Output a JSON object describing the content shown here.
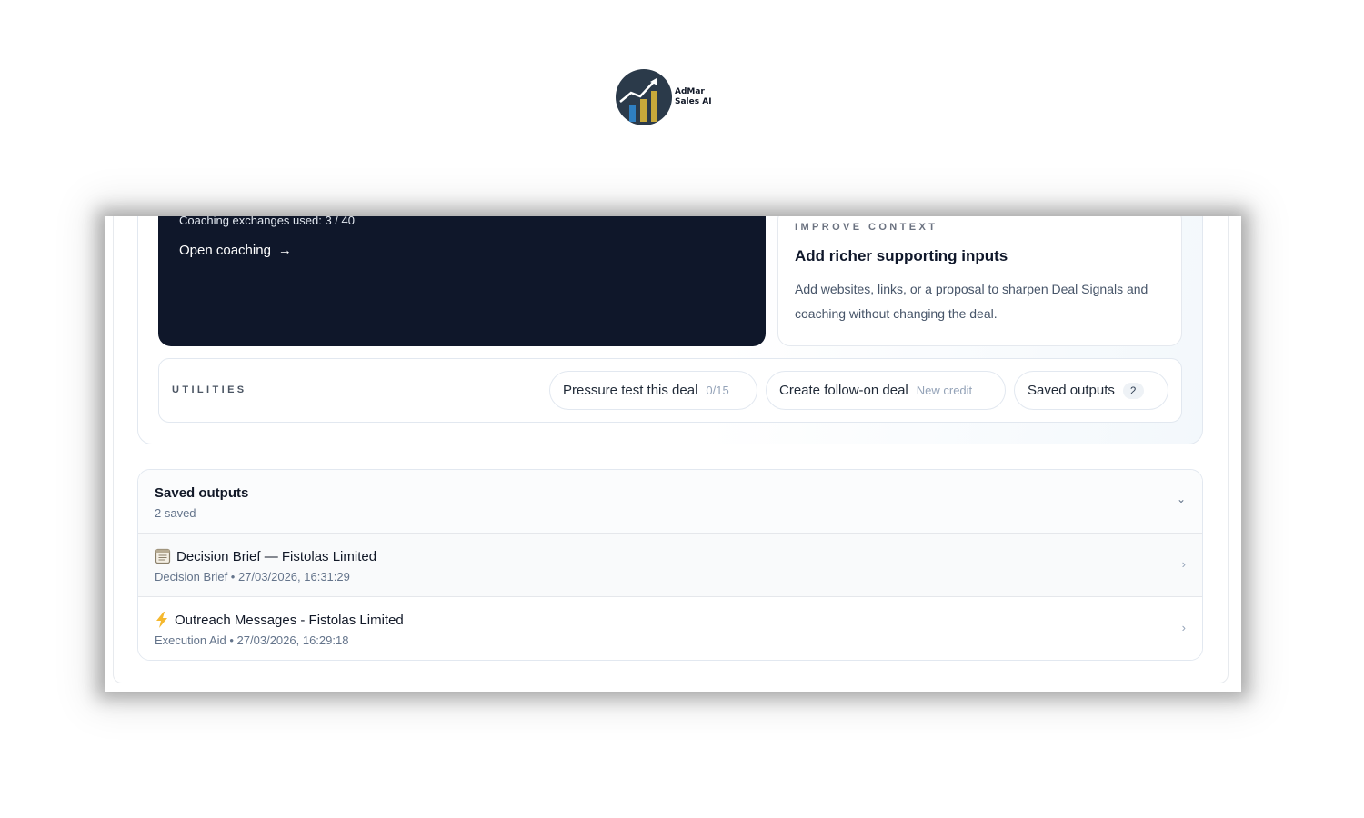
{
  "logo": {
    "line1": "AdMar",
    "line2": "Sales AI"
  },
  "coaching": {
    "usage": "Coaching exchanges used: 3 / 40",
    "link_label": "Open coaching"
  },
  "context": {
    "eyebrow": "IMPROVE CONTEXT",
    "title": "Add richer supporting inputs",
    "body": "Add websites, links, or a proposal to sharpen Deal Signals and coaching without changing the deal."
  },
  "utilities": {
    "label": "UTILITIES",
    "pressure": {
      "label": "Pressure test this deal",
      "meta": "0/15"
    },
    "followon": {
      "label": "Create follow-on deal",
      "meta": "New credit"
    },
    "saved": {
      "label": "Saved outputs",
      "count": "2"
    }
  },
  "saved": {
    "title": "Saved outputs",
    "subtitle": "2 saved",
    "items": [
      {
        "icon": "document-icon",
        "title": "Decision Brief — Fistolas Limited",
        "meta": "Decision Brief • 27/03/2026, 16:31:29"
      },
      {
        "icon": "lightning-icon",
        "title": "Outreach Messages - Fistolas Limited",
        "meta": "Execution Aid • 27/03/2026, 16:29:18"
      }
    ]
  },
  "colors": {
    "navy": "#0f172a",
    "logo_blue": "#2f7fc1",
    "logo_gold": "#c8a93a",
    "bolt": "#f5b82e"
  }
}
